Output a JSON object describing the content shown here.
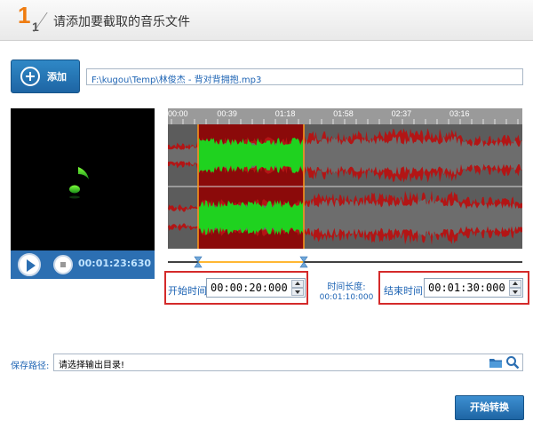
{
  "header": {
    "step_current": "1",
    "step_total": "1",
    "title": "请添加要截取的音乐文件"
  },
  "toolbar": {
    "add_label": "添加",
    "file_path": "F:\\kugou\\Temp\\林俊杰 - 背对背拥抱.mp3"
  },
  "player": {
    "time": "00:01:23:630"
  },
  "waveform": {
    "ruler_labels": [
      "00:00",
      "00:39",
      "01:18",
      "01:58",
      "02:37",
      "03:16"
    ],
    "colors": {
      "background": "#8b0a0a",
      "selected": "#1fd21f",
      "unselected": "#5c5c5c",
      "marker": "#ff9a1a",
      "ruler": "#9a9a9a"
    }
  },
  "selection": {
    "start_label": "开始时间:",
    "start_value": "00:00:20:000",
    "end_label": "结束时间:",
    "end_value": "00:01:30:000",
    "duration_label": "时间长度:",
    "duration_value": "00:01:10:000"
  },
  "output": {
    "label": "保存路径:",
    "placeholder": "请选择输出目录!"
  },
  "actions": {
    "convert_label": "开始转换"
  }
}
